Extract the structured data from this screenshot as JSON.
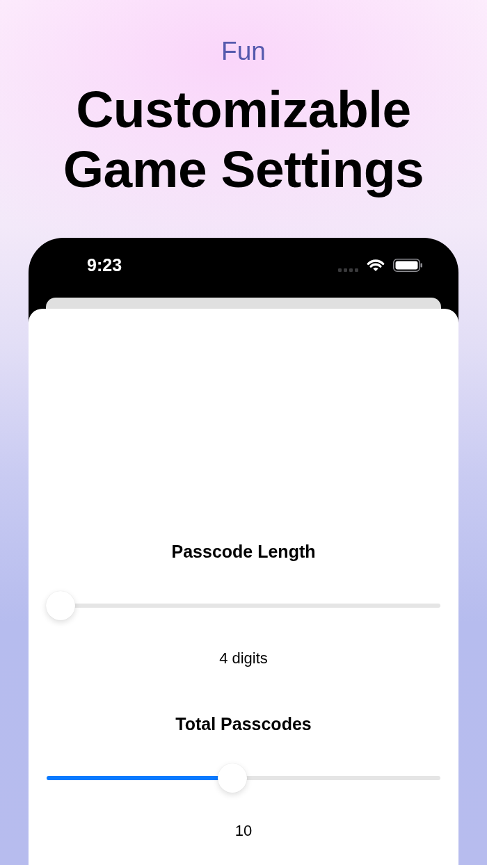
{
  "header": {
    "eyebrow": "Fun",
    "title": "Customizable Game Settings"
  },
  "status_bar": {
    "time": "9:23"
  },
  "settings": [
    {
      "label": "Passcode Length",
      "level": 0,
      "value": "4 digits"
    },
    {
      "label": "Total Passcodes",
      "level": 0.47,
      "value": "10"
    }
  ]
}
